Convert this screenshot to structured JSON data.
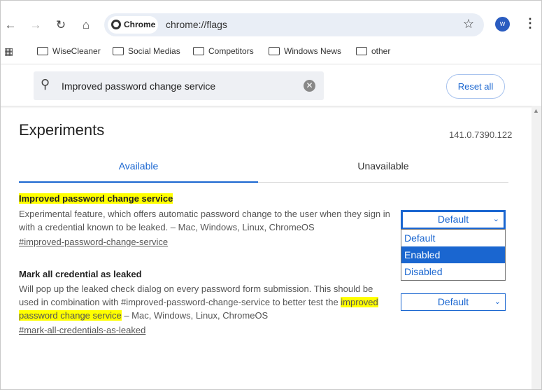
{
  "toolbar": {
    "chip": "Chrome",
    "url": "chrome://flags",
    "avatar": "W"
  },
  "bookmarks": [
    "WiseCleaner",
    "Social Medias",
    "Competitors",
    "Windows News",
    "other"
  ],
  "search": {
    "value": "Improved password change service"
  },
  "reset_label": "Reset all",
  "page": {
    "title": "Experiments",
    "version": "141.0.7390.122",
    "tabs": [
      "Available",
      "Unavailable"
    ]
  },
  "flags": [
    {
      "title": "Improved password change service",
      "desc": "Experimental feature, which offers automatic password change to the user when they sign in with a credential known to be leaked. – Mac, Windows, Linux, ChromeOS",
      "link": "#improved-password-change-service",
      "value": "Default",
      "options": [
        "Default",
        "Enabled",
        "Disabled"
      ]
    },
    {
      "title": "Mark all credential as leaked",
      "desc_pre": "Will pop up the leaked check dialog on every password form submission. This should be used in combination with #improved-password-change-service to better test the ",
      "desc_hl": "improved password change service",
      "desc_post": " – Mac, Windows, Linux, ChromeOS",
      "link": "#mark-all-credentials-as-leaked",
      "value": "Default"
    }
  ],
  "colors": {
    "accent": "#1a66d0",
    "highlight": "#ffff00"
  }
}
